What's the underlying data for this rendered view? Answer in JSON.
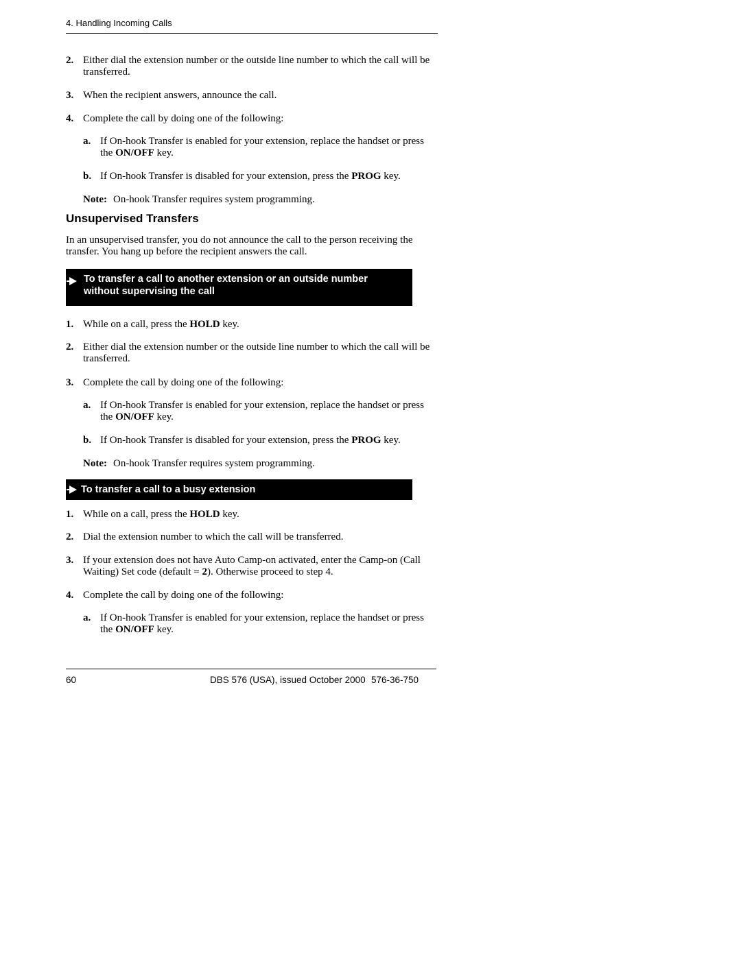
{
  "header": {
    "chapter": "4. Handling Incoming Calls"
  },
  "intro_steps": [
    {
      "num": "2.",
      "text": "Either dial the extension number or the outside line number to which the call will be transferred."
    },
    {
      "num": "3.",
      "text": "When the recipient answers, announce the call."
    },
    {
      "num": "4.",
      "text": "Complete the call by doing one of the following:"
    }
  ],
  "intro_substeps": [
    {
      "num": "a.",
      "pre": "If On-hook Transfer is enabled for your extension, replace the handset or press the ",
      "key": "ON/OFF",
      "post": " key."
    },
    {
      "num": "b.",
      "pre": "If On-hook Transfer is disabled for your extension, press the ",
      "key": "PROG",
      "post": " key."
    }
  ],
  "intro_note": {
    "label": "Note:",
    "text": "On-hook Transfer requires system programming."
  },
  "section": {
    "title": "Unsupervised Transfers",
    "paragraph": "In an unsupervised transfer, you do not announce the call to the person receiving the transfer. You hang up before the recipient answers the call."
  },
  "procedure1": {
    "icon": "arrow-right-icon",
    "title": "To transfer a call to another extension or an outside number without supervising the call",
    "steps": [
      {
        "num": "1.",
        "pre": "While on a call, press the ",
        "key": "HOLD",
        "post": " key."
      },
      {
        "num": "2.",
        "pre": "Either dial the extension number or the outside line number to which the call will be transferred.",
        "key": "",
        "post": ""
      },
      {
        "num": "3.",
        "pre": "Complete the call by doing one of the following:",
        "key": "",
        "post": ""
      }
    ],
    "substeps": [
      {
        "num": "a.",
        "pre": "If On-hook Transfer is enabled for your extension, replace the handset or press the ",
        "key": "ON/OFF",
        "post": " key."
      },
      {
        "num": "b.",
        "pre": "If On-hook Transfer is disabled for your extension, press the ",
        "key": "PROG",
        "post": " key."
      }
    ],
    "note": {
      "label": "Note:",
      "text": "On-hook Transfer requires system programming."
    }
  },
  "procedure2": {
    "icon": "arrow-right-icon",
    "title": "To transfer a call to a busy extension",
    "steps": [
      {
        "num": "1.",
        "pre": "While on a call, press the ",
        "key": "HOLD",
        "post": " key."
      },
      {
        "num": "2.",
        "pre": "Dial the extension number to which the call will be transferred.",
        "key": "",
        "post": ""
      },
      {
        "num": "3.",
        "pre": "If your extension does not have Auto Camp-on activated, enter the Camp-on (Call Waiting) Set code (default = ",
        "key": "2",
        "post": "). Otherwise proceed to step 4."
      },
      {
        "num": "4.",
        "pre": "Complete the call by doing one of the following:",
        "key": "",
        "post": ""
      }
    ],
    "substeps": [
      {
        "num": "a.",
        "pre": "If On-hook Transfer is enabled for your extension, replace the handset or press the ",
        "key": "ON/OFF",
        "post": " key."
      }
    ]
  },
  "footer": {
    "page_number": "60",
    "doc_title": "DBS 576 (USA), issued October 2000",
    "doc_number": "576-36-750"
  }
}
